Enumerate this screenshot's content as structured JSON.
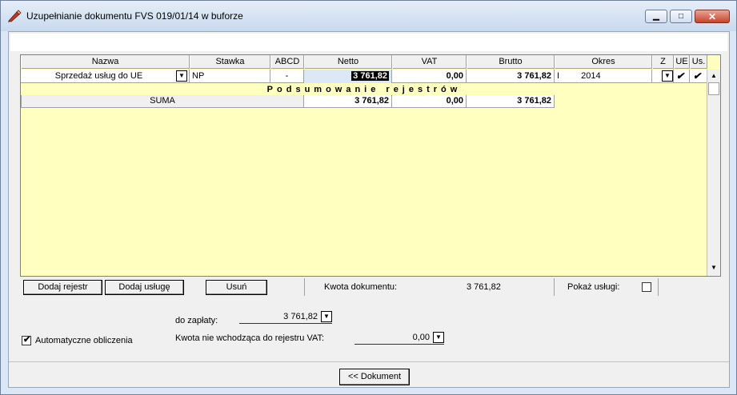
{
  "window": {
    "title": "Uzupełnianie dokumentu FVS  019/01/14 w buforze",
    "minimize_glyph": "▁",
    "maximize_glyph": "□",
    "close_glyph": "✕"
  },
  "grid": {
    "headers": [
      "Nazwa",
      "Stawka",
      "ABCD",
      "Netto",
      "VAT",
      "Brutto",
      "Okres",
      "Z",
      "UE",
      "Us."
    ],
    "row": {
      "nazwa": "Sprzedaż usług do UE",
      "stawka": "NP",
      "abcd": "-",
      "netto": "3 761,82",
      "vat": "0,00",
      "brutto": "3 761,82",
      "okres_month": "I",
      "okres_year": "2014",
      "ue_check": "✔",
      "us_check": "✔"
    },
    "summary_title": "Podsumowanie rejestrów",
    "summary": {
      "label": "SUMA",
      "netto": "3 761,82",
      "vat": "0,00",
      "brutto": "3 761,82"
    }
  },
  "buttons": {
    "dodaj_rejestr": "Dodaj rejestr",
    "dodaj_usluge": "Dodaj usługę",
    "usun": "Usuń",
    "dokument": "<< Dokument"
  },
  "info": {
    "kwota_label": "Kwota dokumentu:",
    "kwota_value": "3 761,82",
    "pokaz_uslugi_label": "Pokaż usługi:",
    "pokaz_uslugi_checked": false
  },
  "footer": {
    "do_zaplaty_label": "do zapłaty:",
    "do_zaplaty_value": "3 761,82",
    "kwota_nie_label": "Kwota nie wchodząca do rejestru VAT:",
    "kwota_nie_value": "0,00",
    "auto_label": "Automatyczne obliczenia",
    "auto_checked": true,
    "check_glyph": "✔"
  },
  "icons": {
    "dropdown": "▼",
    "scroll_up": "▲",
    "scroll_down": "▼"
  }
}
